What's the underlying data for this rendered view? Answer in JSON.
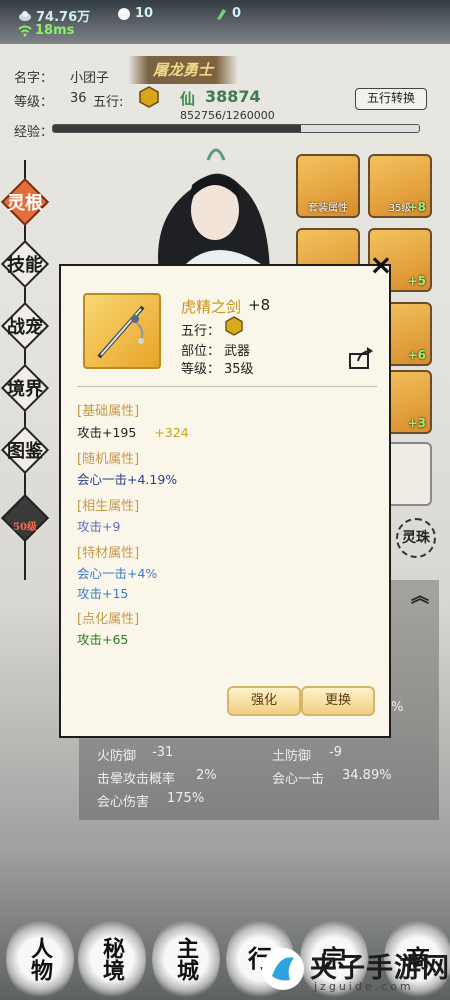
{
  "topbar": {
    "silver": "74.76万",
    "pearl": "10",
    "jade": "0",
    "ping": "18ms"
  },
  "player": {
    "name_label": "名字：",
    "name": "小团子",
    "title": "屠龙勇士",
    "level_label": "等级：",
    "level": "36",
    "wuxing_label": "五行:",
    "xian_char": "仙",
    "xian_value": "38874",
    "wuxing_button": "五行转换",
    "exp_label": "经验：",
    "exp_text": "852756/1260000",
    "exp_fraction": 0.677
  },
  "side_menu": [
    {
      "label": "灵根"
    },
    {
      "label": "技能"
    },
    {
      "label": "战宠"
    },
    {
      "label": "境界"
    },
    {
      "label": "图鉴"
    },
    {
      "label": "50级"
    }
  ],
  "slots": {
    "set_attr": "套装属性",
    "lvl35": "35级",
    "plus8": "+8",
    "plus5": "+5",
    "plus6": "+6",
    "plus3": "+3",
    "lingzhu": "灵珠"
  },
  "stats_bg": [
    {
      "label": "火防御",
      "value": "-31"
    },
    {
      "label": "土防御",
      "value": "-9"
    },
    {
      "label": "击晕攻击概率",
      "value": "2%"
    },
    {
      "label": "会心一击",
      "value": "34.89%"
    },
    {
      "label": "会心伤害",
      "value": "175%"
    }
  ],
  "stats_bg_partial": "%",
  "bottom_nav": [
    {
      "label": "人物"
    },
    {
      "label": "秘境"
    },
    {
      "label": "主城"
    },
    {
      "label": "行"
    },
    {
      "label": "宗"
    },
    {
      "label": "商"
    }
  ],
  "watermark": {
    "brand": "夹子手游网",
    "url": "jzguide.com"
  },
  "modal": {
    "close": "×",
    "item_name": "虎精之剑",
    "item_plus": "+8",
    "wuxing_label": "五行：",
    "part_label": "部位：",
    "part_value": "武器",
    "level_label": "等级：",
    "level_value": "35级",
    "sections": [
      {
        "title": "[基础属性]",
        "lines": [
          {
            "text": "攻击+195",
            "extra": "+324",
            "color": "#222222"
          }
        ]
      },
      {
        "title": "[随机属性]",
        "lines": [
          {
            "text": "会心一击+4.19%",
            "color": "#2a3f8f"
          }
        ]
      },
      {
        "title": "[相生属性]",
        "lines": [
          {
            "text": "攻击+9",
            "color": "#5a6fc2"
          }
        ]
      },
      {
        "title": "[特材属性]",
        "lines": [
          {
            "text": "会心一击+4%",
            "color": "#3b7dc9"
          },
          {
            "text": "攻击+15",
            "color": "#3b7dc9"
          }
        ]
      },
      {
        "title": "[点化属性]",
        "lines": [
          {
            "text": "攻击+65",
            "color": "#2d7a1e"
          }
        ]
      }
    ],
    "btn_enhance": "强化",
    "btn_replace": "更换"
  },
  "colors": {
    "gold_text": "#c9921a",
    "section_title": "#c59a4a",
    "extra_gold": "#c9a020"
  }
}
